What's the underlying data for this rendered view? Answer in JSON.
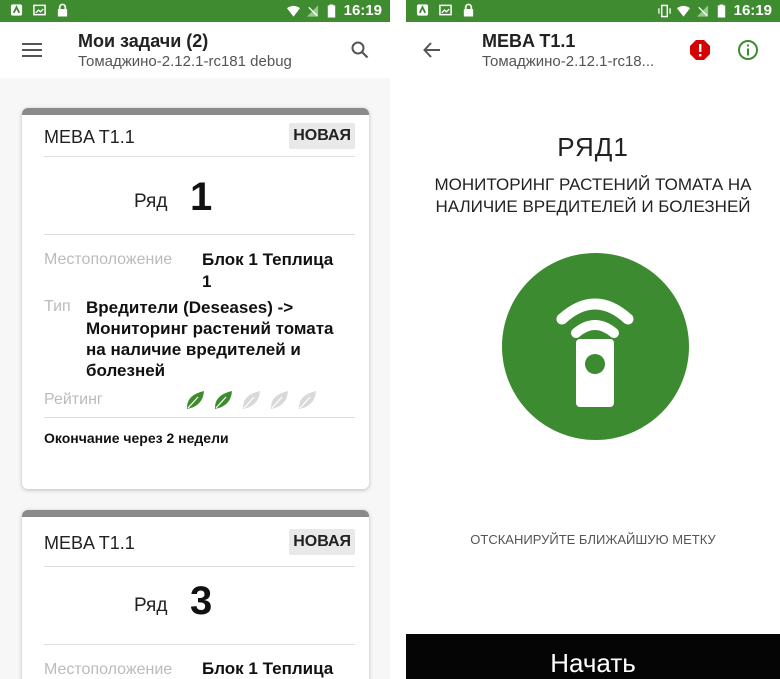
{
  "colors": {
    "accent": "#3f8b30",
    "warning": "#d50000"
  },
  "left": {
    "status_time": "16:19",
    "title": "Мои задачи (2)",
    "subtitle": "Томаджино-2.12.1-rc181 debug",
    "tasks": [
      {
        "code": "MEBA T1.1",
        "badge": "НОВАЯ",
        "row_word": "Ряд",
        "row_number": "1",
        "location_label": "Местоположение",
        "location_value_1": "Блок 1 Теплица",
        "location_value_2": "1",
        "type_label": "Тип",
        "type_value_1": "Вредители (Deseases) ->",
        "type_value_2": "Мониторинг растений томата",
        "type_value_3": "на наличие вредителей и",
        "type_value_4": "болезней",
        "rating_label": "Рейтинг",
        "rating": 2,
        "rating_max": 5,
        "footer": "Окончание через 2 недели"
      },
      {
        "code": "MEBA T1.1",
        "badge": "НОВАЯ",
        "row_word": "Ряд",
        "row_number": "3",
        "location_label": "Местоположение",
        "location_value_1": "Блок 1 Теплица"
      }
    ]
  },
  "right": {
    "status_time": "16:19",
    "title": "MEBA T1.1",
    "subtitle": "Томаджино-2.12.1-rc18...",
    "row_heading": "РЯД1",
    "description_1": "МОНИТОРИНГ РАСТЕНИЙ ТОМАТА НА",
    "description_2": "НАЛИЧИЕ ВРЕДИТЕЛЕЙ И БОЛЕЗНЕЙ",
    "hint": "ОТСКАНИРУЙТЕ БЛИЖАЙШУЮ МЕТКУ",
    "start_button": "Начать"
  }
}
